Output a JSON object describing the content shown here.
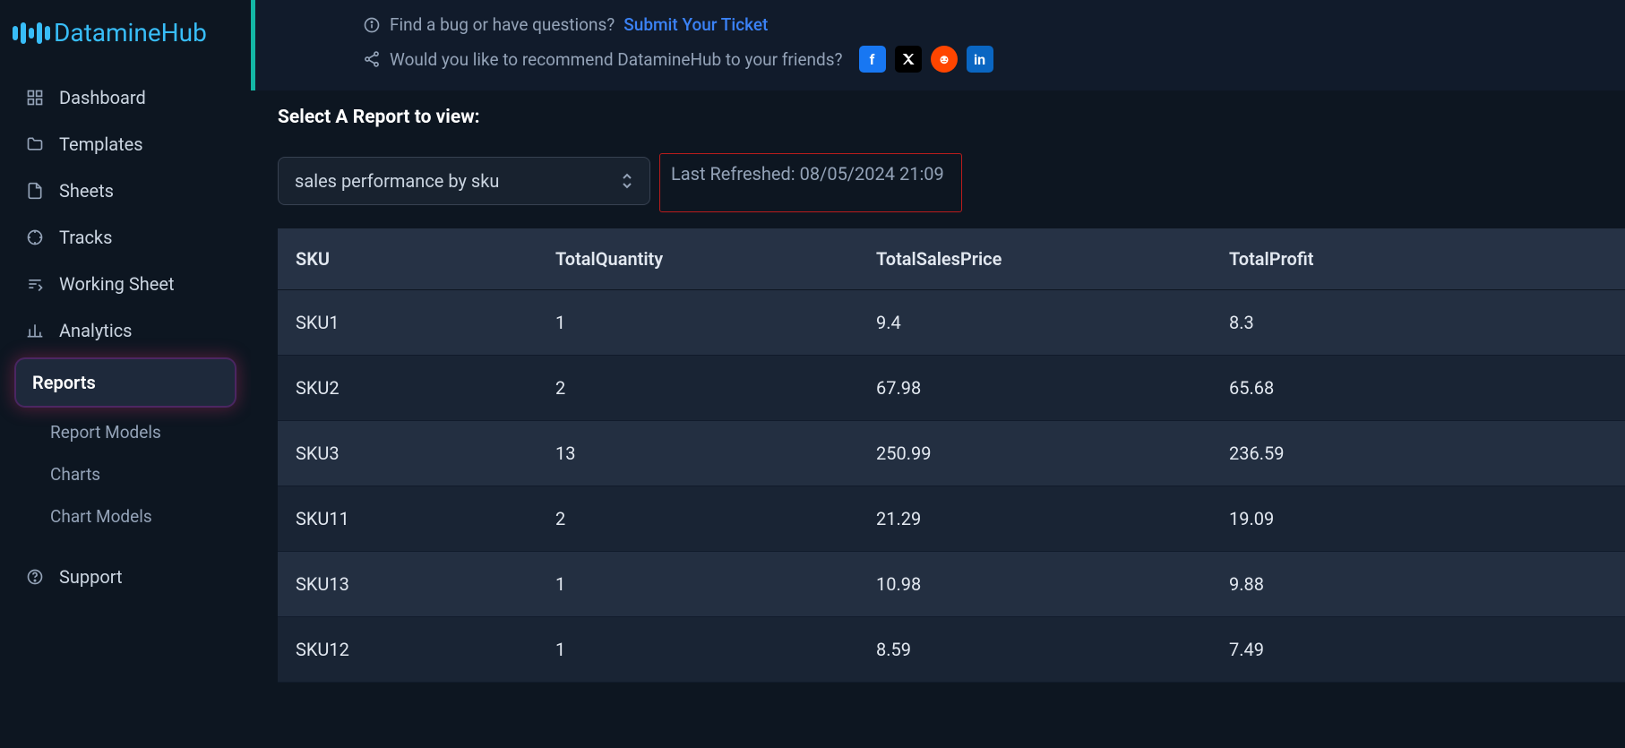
{
  "brand": "DatamineHub",
  "sidebar": {
    "items": [
      {
        "label": "Dashboard"
      },
      {
        "label": "Templates"
      },
      {
        "label": "Sheets"
      },
      {
        "label": "Tracks"
      },
      {
        "label": "Working Sheet"
      },
      {
        "label": "Analytics"
      },
      {
        "label": "Reports"
      },
      {
        "label": "Report Models"
      },
      {
        "label": "Charts"
      },
      {
        "label": "Chart Models"
      },
      {
        "label": "Support"
      }
    ]
  },
  "banner": {
    "bug_text": "Find a bug or have questions?",
    "bug_link": "Submit Your Ticket",
    "recommend_text": "Would you like to recommend DatamineHub to your friends?"
  },
  "report": {
    "title": "Select A Report to view:",
    "selected": "sales performance by sku",
    "last_refreshed_label": "Last Refreshed:",
    "last_refreshed_value": "08/05/2024 21:09"
  },
  "table": {
    "headers": [
      "SKU",
      "TotalQuantity",
      "TotalSalesPrice",
      "TotalProfit"
    ],
    "rows": [
      [
        "SKU1",
        "1",
        "9.4",
        "8.3"
      ],
      [
        "SKU2",
        "2",
        "67.98",
        "65.68"
      ],
      [
        "SKU3",
        "13",
        "250.99",
        "236.59"
      ],
      [
        "SKU11",
        "2",
        "21.29",
        "19.09"
      ],
      [
        "SKU13",
        "1",
        "10.98",
        "9.88"
      ],
      [
        "SKU12",
        "1",
        "8.59",
        "7.49"
      ]
    ]
  }
}
